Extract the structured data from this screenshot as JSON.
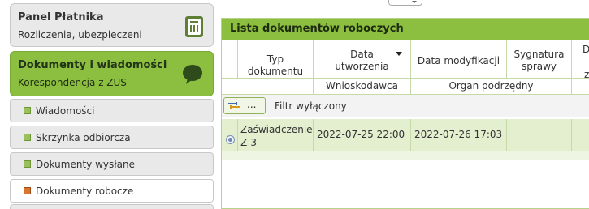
{
  "sidebar": {
    "panel": {
      "title": "Panel Płatnika",
      "subtitle": "Rozliczenia, ubezpieczeni",
      "icon": "building-icon"
    },
    "documents": {
      "title": "Dokumenty i wiadomości",
      "subtitle": "Korespondencja z ZUS",
      "icon": "speech-bubble-icon"
    },
    "items": [
      {
        "label": "Wiadomości"
      },
      {
        "label": "Skrzynka odbiorcza"
      },
      {
        "label": "Dokumenty wysłane"
      },
      {
        "label": "Dokumenty robocze",
        "active": true
      }
    ]
  },
  "main": {
    "title": "Lista dokumentów roboczych",
    "columns": {
      "typ_line1": "Typ",
      "typ_line2": "dokumentu",
      "data_utw_line1": "Data",
      "data_utw_line2": "utworzenia",
      "data_mod": "Data modyfikacji",
      "sygn_line1": "Sygnatura",
      "sygn_line2": "sprawy",
      "cut_line1": "D",
      "cut_line2": "z"
    },
    "subheaders": {
      "wnioskodawca": "Wnioskodawca",
      "organ": "Organ podrzędny"
    },
    "filter": {
      "button_dots": "...",
      "label": "Filtr wyłączony"
    },
    "rows": [
      {
        "typ_line1": "Zaświadczenie",
        "typ_line2": "Z-3",
        "data_utworzenia": "2022-07-25 22:00",
        "data_modyfikacji": "2022-07-26 17:03"
      }
    ]
  },
  "colors": {
    "accent": "#8cbf3f",
    "row_highlight": "#e3efcf",
    "active_bullet": "#d8752e"
  }
}
